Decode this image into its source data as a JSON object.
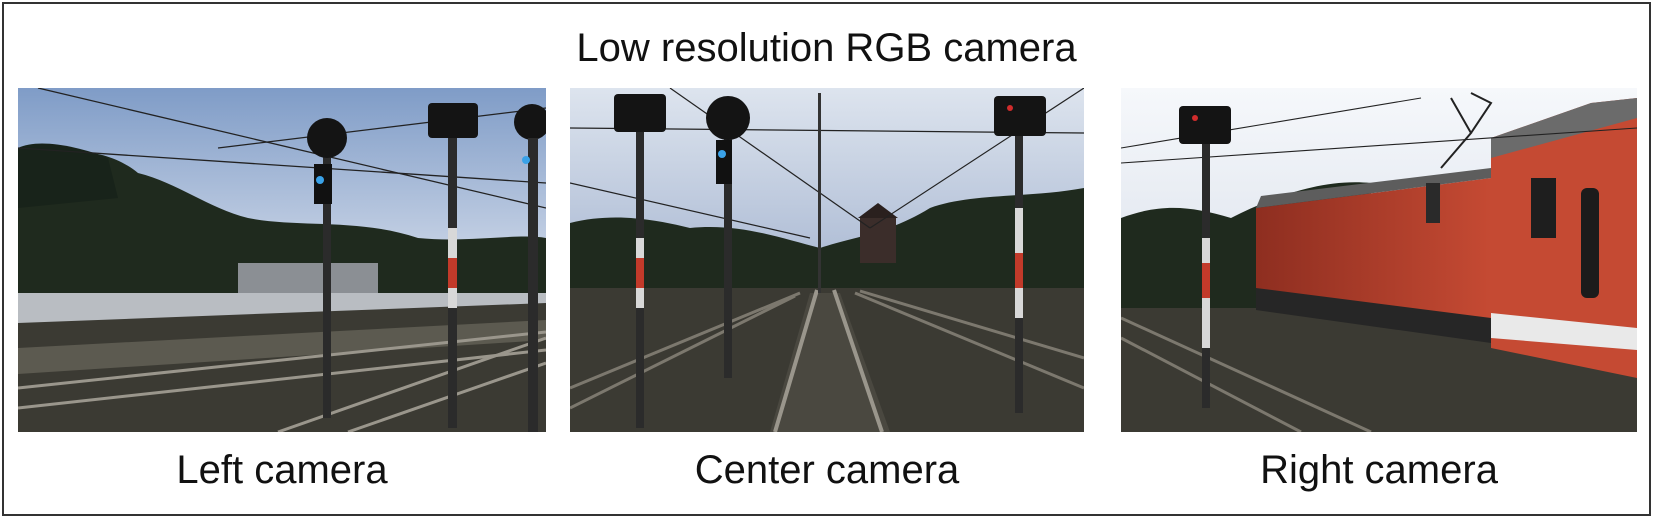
{
  "title": "Low resolution RGB camera",
  "cameras": [
    {
      "caption": "Left camera"
    },
    {
      "caption": "Center camera"
    },
    {
      "caption": "Right camera"
    }
  ],
  "colors": {
    "frame_border": "#333333",
    "sky": "#cfd8e6",
    "trees": "#1f2a1e",
    "ground": "#3b3a33",
    "rail": "#9a968c",
    "train_red": "#b8402c"
  }
}
